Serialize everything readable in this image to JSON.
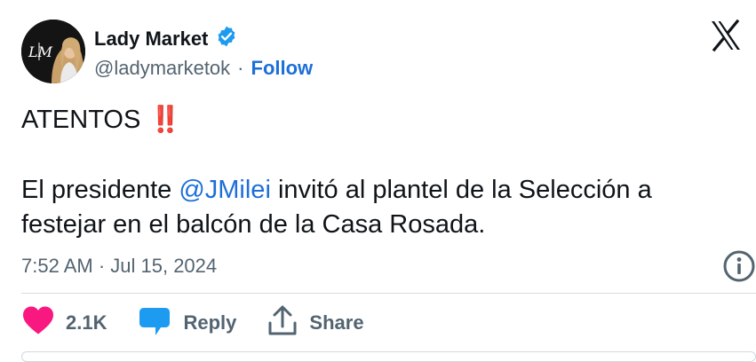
{
  "author": {
    "name": "Lady Market",
    "handle": "@ladymarketok",
    "separator": "·",
    "follow_label": "Follow",
    "avatar_monogram": "LM",
    "verified_color": "#1d9bf0"
  },
  "brand": {
    "logo_icon": "x-logo-icon"
  },
  "tweet": {
    "line1": "ATENTOS",
    "emoji": "‼️",
    "line2_pre": "El presidente ",
    "mention": "@JMilei",
    "line2_post": " invitó al plantel de la Selección a",
    "line3": "festejar en el balcón de la Casa Rosada.",
    "timestamp": "7:52 AM · Jul 15, 2024"
  },
  "actions": {
    "likes": "2.1K",
    "reply_label": "Reply",
    "share_label": "Share"
  },
  "colors": {
    "accent": "#1d6fd8",
    "like_heart": "#f91880",
    "reply_bubble": "#1d9bf0",
    "emoji_red": "#d4202f",
    "muted_text": "#536471"
  }
}
